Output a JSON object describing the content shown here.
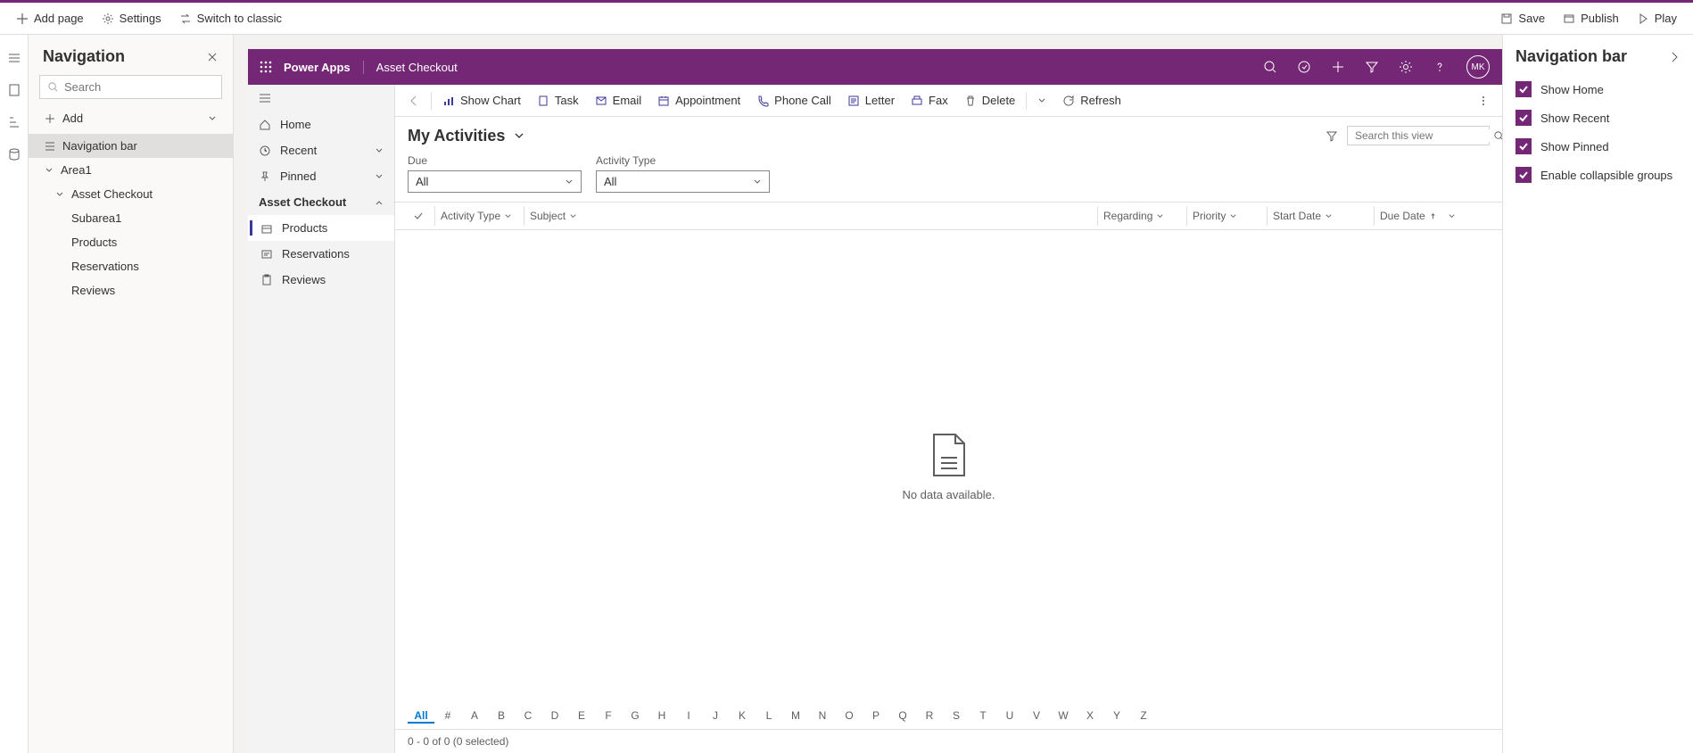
{
  "toolbar": {
    "addPage": "Add page",
    "settings": "Settings",
    "switch": "Switch to classic",
    "save": "Save",
    "publish": "Publish",
    "play": "Play"
  },
  "navPanel": {
    "title": "Navigation",
    "searchPlaceholder": "Search",
    "add": "Add",
    "items": {
      "navbar": "Navigation bar",
      "area1": "Area1",
      "assetCheckout": "Asset Checkout",
      "subarea1": "Subarea1",
      "products": "Products",
      "reservations": "Reservations",
      "reviews": "Reviews"
    }
  },
  "appHdr": {
    "brand": "Power Apps",
    "appName": "Asset Checkout",
    "avatar": "MK"
  },
  "siteNav": {
    "home": "Home",
    "recent": "Recent",
    "pinned": "Pinned",
    "group": "Asset Checkout",
    "products": "Products",
    "reservations": "Reservations",
    "reviews": "Reviews"
  },
  "cmdbar": {
    "showChart": "Show Chart",
    "task": "Task",
    "email": "Email",
    "appointment": "Appointment",
    "phone": "Phone Call",
    "letter": "Letter",
    "fax": "Fax",
    "delete": "Delete",
    "refresh": "Refresh"
  },
  "view": {
    "title": "My Activities",
    "searchPlaceholder": "Search this view",
    "dueLabel": "Due",
    "dueValue": "All",
    "typeLabel": "Activity Type",
    "typeValue": "All",
    "cols": {
      "activityType": "Activity Type",
      "subject": "Subject",
      "regarding": "Regarding",
      "priority": "Priority",
      "startDate": "Start Date",
      "dueDate": "Due Date"
    },
    "empty": "No data available.",
    "alphabet": [
      "All",
      "#",
      "A",
      "B",
      "C",
      "D",
      "E",
      "F",
      "G",
      "H",
      "I",
      "J",
      "K",
      "L",
      "M",
      "N",
      "O",
      "P",
      "Q",
      "R",
      "S",
      "T",
      "U",
      "V",
      "W",
      "X",
      "Y",
      "Z"
    ],
    "status": "0 - 0 of 0 (0 selected)"
  },
  "propPanel": {
    "title": "Navigation bar",
    "opts": {
      "home": "Show Home",
      "recent": "Show Recent",
      "pinned": "Show Pinned",
      "collapse": "Enable collapsible groups"
    }
  }
}
